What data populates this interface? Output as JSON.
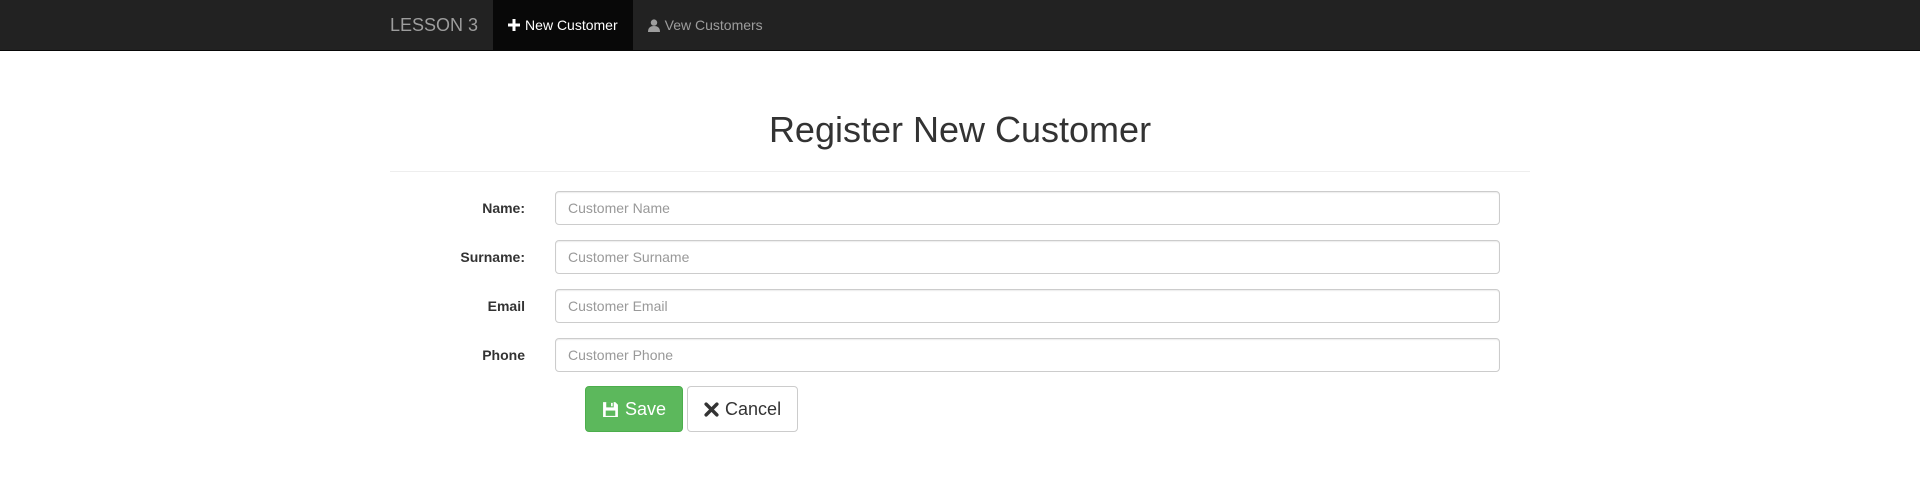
{
  "navbar": {
    "brand": "LESSON 3",
    "items": [
      {
        "label": "New Customer",
        "icon": "plus-icon",
        "active": true
      },
      {
        "label": "Vew Customers",
        "icon": "user-icon",
        "active": false
      }
    ]
  },
  "page": {
    "title": "Register New Customer"
  },
  "form": {
    "fields": [
      {
        "label": "Name:",
        "placeholder": "Customer Name",
        "value": ""
      },
      {
        "label": "Surname:",
        "placeholder": "Customer Surname",
        "value": ""
      },
      {
        "label": "Email",
        "placeholder": "Customer Email",
        "value": ""
      },
      {
        "label": "Phone",
        "placeholder": "Customer Phone",
        "value": ""
      }
    ],
    "save_label": "Save",
    "save_icon": "floppy-disk-icon",
    "cancel_label": "Cancel",
    "cancel_icon": "close-icon"
  },
  "colors": {
    "navbar_bg": "#222222",
    "navbar_active_bg": "#080808",
    "save_button": "#5cb85c"
  }
}
